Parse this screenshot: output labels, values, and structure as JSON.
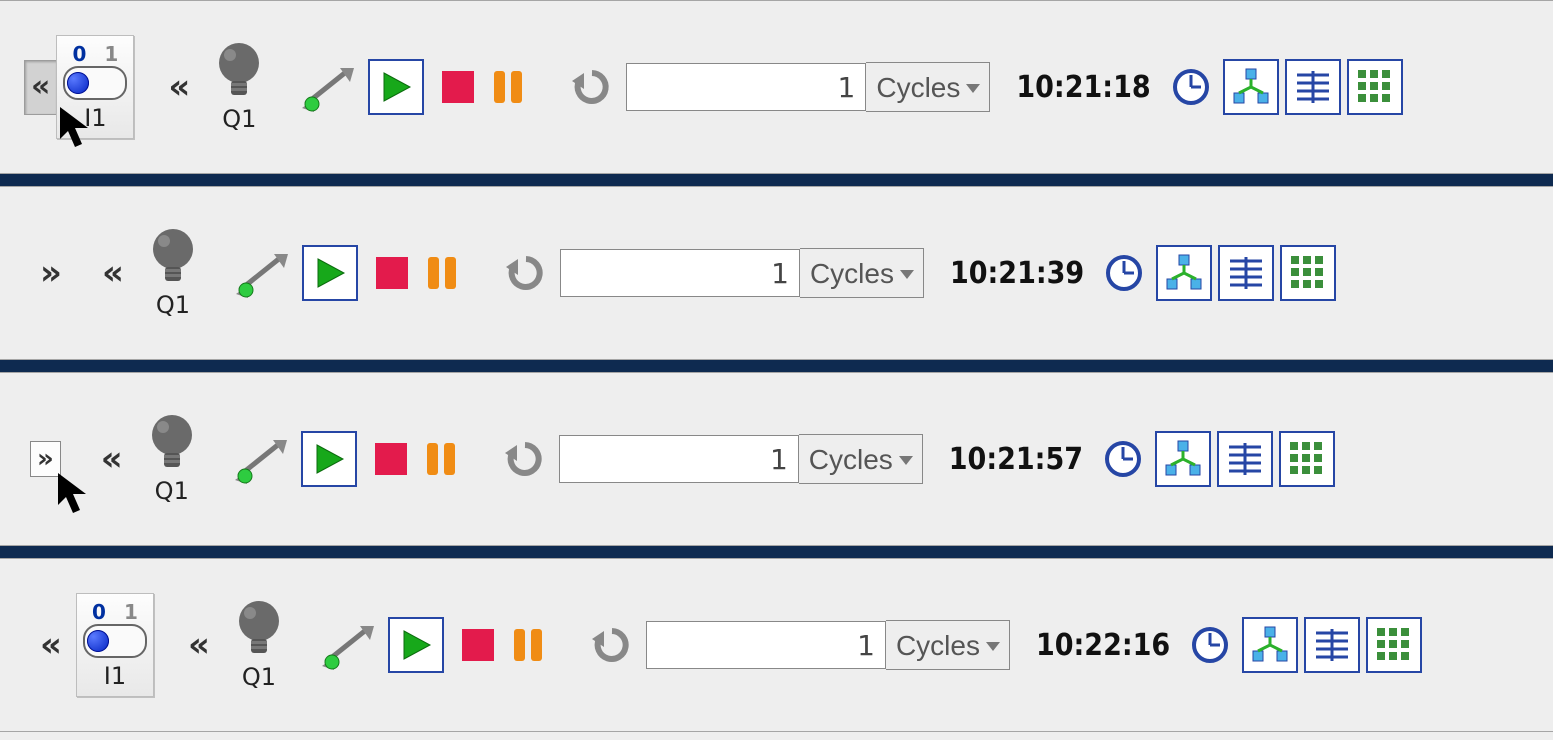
{
  "rows": [
    {
      "has_toggle": true,
      "toggle_pressed": true,
      "left_chev_inside": "«",
      "left_chev": "«",
      "toggle_on_label": "0",
      "toggle_off_label": "1",
      "toggle_caption": "I1",
      "bulb_caption": "Q1",
      "count_value": "1",
      "unit": "Cycles",
      "time": "10:21:18",
      "expand_chev": null,
      "cursor_at": "toggle"
    },
    {
      "has_toggle": false,
      "toggle_pressed": false,
      "left_chev": "«",
      "bulb_caption": "Q1",
      "count_value": "1",
      "unit": "Cycles",
      "time": "10:21:39",
      "expand_chev": "»",
      "cursor_at": null
    },
    {
      "has_toggle": false,
      "toggle_pressed": false,
      "left_chev": "«",
      "bulb_caption": "Q1",
      "count_value": "1",
      "unit": "Cycles",
      "time": "10:21:57",
      "expand_chev_boxed": "»",
      "cursor_at": "expand"
    },
    {
      "has_toggle": true,
      "toggle_pressed": false,
      "left_chev_inside": null,
      "collapse_chev": "«",
      "left_chev": "«",
      "toggle_on_label": "0",
      "toggle_off_label": "1",
      "toggle_caption": "I1",
      "bulb_caption": "Q1",
      "count_value": "1",
      "unit": "Cycles",
      "time": "10:22:16",
      "expand_chev": null,
      "cursor_at": null
    }
  ],
  "colors": {
    "accent": "#2646a5",
    "play": "#17a81a",
    "stop": "#e31b4c",
    "pause": "#f08c14",
    "plug_dot": "#2ecc40",
    "divider": "#0e2a50"
  }
}
